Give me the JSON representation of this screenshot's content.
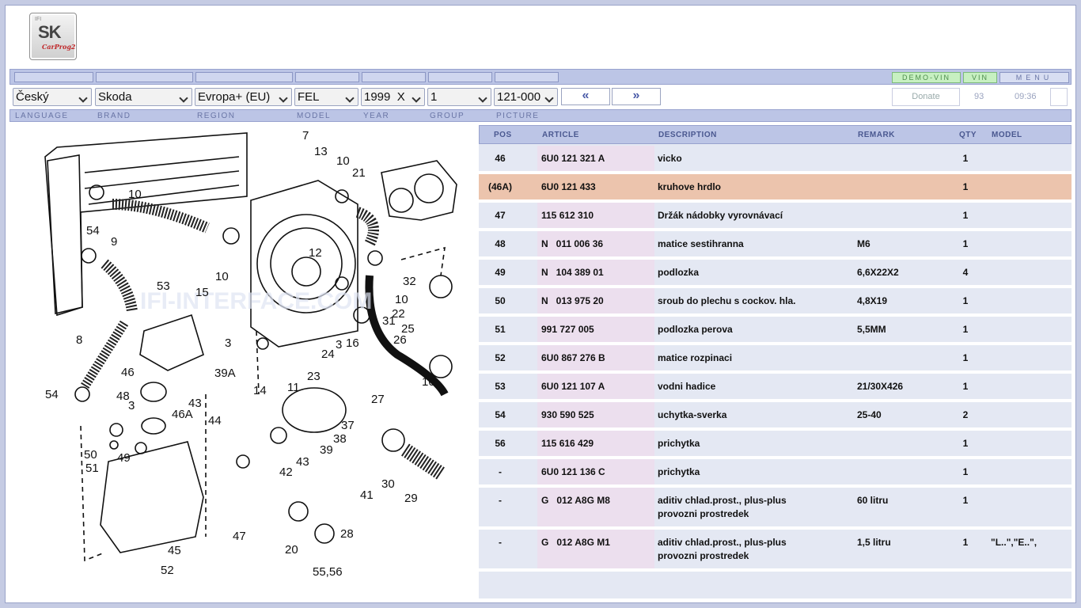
{
  "logo": {
    "ifi": "IFI",
    "sk": "SK",
    "carprog": "CarProg2"
  },
  "topbar": {
    "demo_vin": "DEMO-VIN",
    "vin": "VIN",
    "menu": "MENU"
  },
  "selectors": {
    "language": "Český",
    "brand": "Skoda",
    "region": "Evropa+ (EU)",
    "model": "FEL",
    "year": "1999  X",
    "group": "1",
    "picture": "121-000"
  },
  "nav": {
    "prev": "«",
    "next": "»"
  },
  "info": {
    "donate": "Donate",
    "count": "93",
    "time": "09:36"
  },
  "labels": {
    "language": "LANGUAGE",
    "brand": "BRAND",
    "region": "REGION",
    "model": "MODEL",
    "year": "YEAR",
    "group": "GROUP",
    "picture": "PICTURE"
  },
  "table": {
    "headers": {
      "pos": "POS",
      "article": "ARTICLE",
      "description": "DESCRIPTION",
      "remark": "REMARK",
      "qty": "QTY",
      "model": "MODEL"
    },
    "rows": [
      {
        "pos": "46",
        "article": "6U0 121 321 A",
        "desc1": "vicko",
        "desc2": "",
        "remark": "",
        "qty": "1",
        "model": ""
      },
      {
        "pos": "(46A)",
        "article": "6U0 121 433",
        "desc1": "kruhove hrdlo",
        "desc2": "",
        "remark": "",
        "qty": "1",
        "model": ""
      },
      {
        "pos": "47",
        "article": "115 612 310",
        "desc1": "Držák nádobky vyrovnávací",
        "desc2": "",
        "remark": "",
        "qty": "1",
        "model": ""
      },
      {
        "pos": "48",
        "article": "N   011 006 36",
        "desc1": "matice sestihranna",
        "desc2": "",
        "remark": "M6",
        "qty": "1",
        "model": ""
      },
      {
        "pos": "49",
        "article": "N   104 389 01",
        "desc1": "podlozka",
        "desc2": "",
        "remark": "6,6X22X2",
        "qty": "4",
        "model": ""
      },
      {
        "pos": "50",
        "article": "N   013 975 20",
        "desc1": "sroub do plechu s cockov. hla.",
        "desc2": "",
        "remark": "4,8X19",
        "qty": "1",
        "model": ""
      },
      {
        "pos": "51",
        "article": "991 727 005",
        "desc1": "podlozka perova",
        "desc2": "",
        "remark": "5,5MM",
        "qty": "1",
        "model": ""
      },
      {
        "pos": "52",
        "article": "6U0 867 276 B",
        "desc1": "matice rozpinaci",
        "desc2": "",
        "remark": "",
        "qty": "1",
        "model": ""
      },
      {
        "pos": "53",
        "article": "6U0 121 107 A",
        "desc1": "vodni hadice",
        "desc2": "",
        "remark": "21/30X426",
        "qty": "1",
        "model": ""
      },
      {
        "pos": "54",
        "article": "930 590 525",
        "desc1": "uchytka-sverka",
        "desc2": "",
        "remark": "25-40",
        "qty": "2",
        "model": ""
      },
      {
        "pos": "56",
        "article": "115 616 429",
        "desc1": "prichytka",
        "desc2": "",
        "remark": "",
        "qty": "1",
        "model": ""
      },
      {
        "pos": "-",
        "article": "6U0 121 136 C",
        "desc1": "prichytka",
        "desc2": "",
        "remark": "",
        "qty": "1",
        "model": ""
      },
      {
        "pos": "-",
        "article": "G   012 A8G M8",
        "desc1": "aditiv chlad.prost., plus-plus",
        "desc2": "provozni prostredek",
        "remark": "60 litru",
        "qty": "1",
        "model": ""
      },
      {
        "pos": "-",
        "article": "G   012 A8G M1",
        "desc1": "aditiv chlad.prost., plus-plus",
        "desc2": "provozni prostredek",
        "remark": "1,5 litru",
        "qty": "1",
        "model": "\"L..\",\"E..\","
      }
    ]
  },
  "diagram": {
    "watermark": "IFI-INTERFACE.COM",
    "callouts": [
      "7",
      "13",
      "10",
      "21",
      "10",
      "9",
      "54",
      "10",
      "12",
      "15",
      "53",
      "32",
      "10",
      "31",
      "22",
      "25",
      "26",
      "3",
      "16",
      "8",
      "3",
      "24",
      "23",
      "27",
      "10",
      "39A",
      "14",
      "11",
      "54",
      "46",
      "48",
      "3",
      "43",
      "46A",
      "44",
      "37",
      "38",
      "50",
      "49",
      "51",
      "39",
      "43",
      "42",
      "41",
      "30",
      "29",
      "28",
      "47",
      "20",
      "45",
      "52",
      "55,56"
    ]
  }
}
